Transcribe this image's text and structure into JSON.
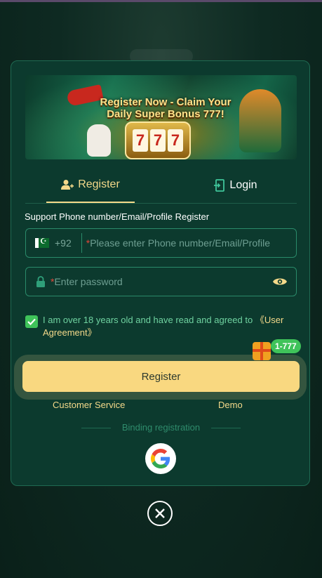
{
  "banner": {
    "title_line1": "Register Now - Claim Your",
    "title_line2": "Daily Super Bonus 777!",
    "slot": [
      "7",
      "7",
      "7"
    ]
  },
  "tabs": {
    "register_label": "Register",
    "login_label": "Login"
  },
  "form": {
    "support_text": "Support Phone number/Email/Profile Register",
    "country_code": "+92",
    "phone_placeholder": "Please enter Phone number/Email/Profile",
    "password_placeholder": "Enter password",
    "required_mark": "*",
    "agreement_text": "I am over 18 years old and have read and agreed to",
    "agreement_link": "《User Agreement》",
    "register_button": "Register",
    "bonus_badge": "1-777"
  },
  "links": {
    "customer_service": "Customer Service",
    "demo": "Demo"
  },
  "binding_label": "Binding registration",
  "colors": {
    "accent": "#f4d98a",
    "panel": "#0c3a2e",
    "check": "#3fc35a",
    "button": "#f9d880"
  }
}
